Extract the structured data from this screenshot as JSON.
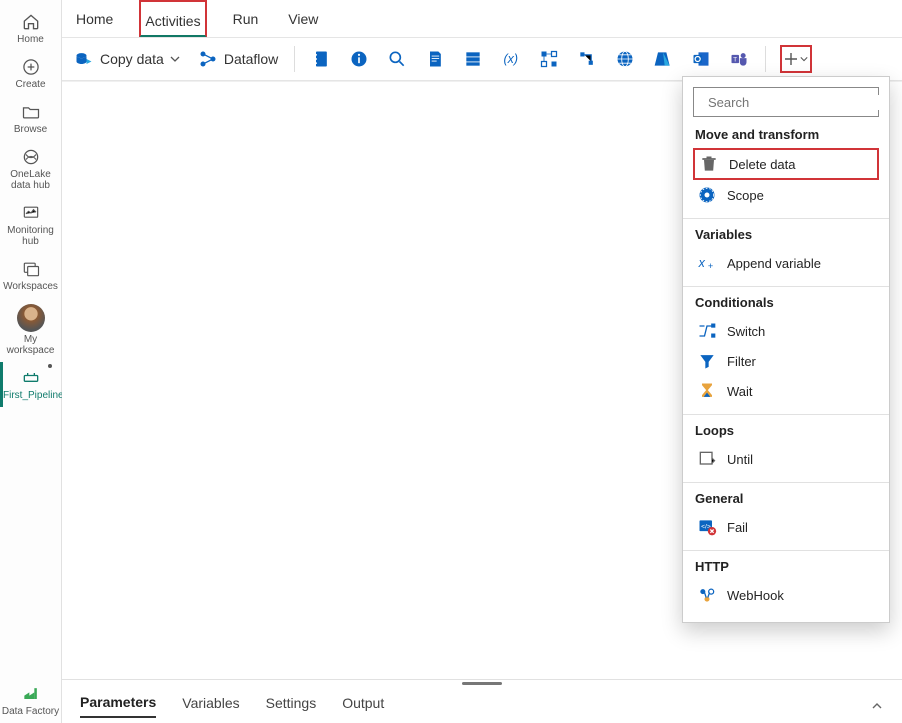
{
  "leftnav": {
    "home": "Home",
    "create": "Create",
    "browse": "Browse",
    "onelake": "OneLake data hub",
    "monitoring": "Monitoring hub",
    "workspaces": "Workspaces",
    "myworkspace": "My workspace",
    "pipeline": "First_Pipeline",
    "datafactory": "Data Factory"
  },
  "tabs": {
    "home": "Home",
    "activities": "Activities",
    "run": "Run",
    "view": "View"
  },
  "toolbar": {
    "copydata": "Copy data",
    "dataflow": "Dataflow"
  },
  "dropdown": {
    "search_placeholder": "Search",
    "groups": {
      "move": "Move and transform",
      "variables": "Variables",
      "conditionals": "Conditionals",
      "loops": "Loops",
      "general": "General",
      "http": "HTTP"
    },
    "items": {
      "delete": "Delete data",
      "scope": "Scope",
      "append": "Append variable",
      "switch": "Switch",
      "filter": "Filter",
      "wait": "Wait",
      "until": "Until",
      "fail": "Fail",
      "webhook": "WebHook"
    }
  },
  "bottom": {
    "parameters": "Parameters",
    "variables": "Variables",
    "settings": "Settings",
    "output": "Output"
  }
}
